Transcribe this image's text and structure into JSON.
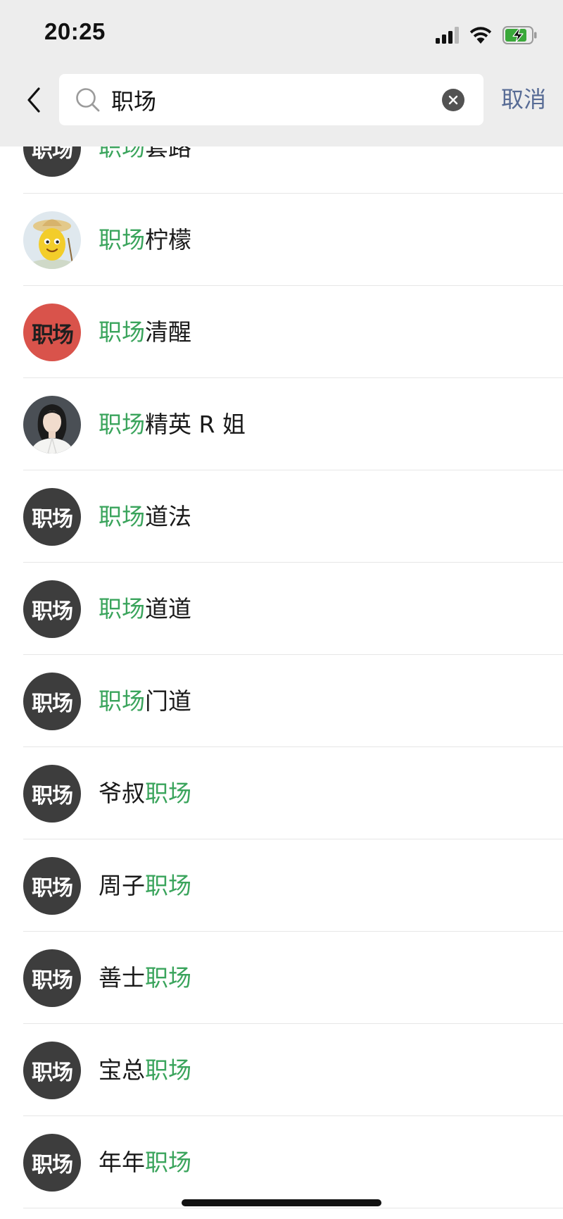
{
  "status_bar": {
    "time": "20:25",
    "signal_icon": "cellular-signal-icon",
    "wifi_icon": "wifi-icon",
    "battery_icon": "battery-charging-icon",
    "battery_color": "#3aa83a"
  },
  "search": {
    "query": "职场",
    "placeholder": "",
    "cancel_label": "取消",
    "back_icon": "chevron-left-icon",
    "search_icon": "search-icon",
    "clear_icon": "clear-icon"
  },
  "colors": {
    "header_bg": "#ededed",
    "highlight": "#3aa45c",
    "link": "#576b95",
    "avatar_dark": "#3d3d3d",
    "avatar_red": "#d9534b"
  },
  "results": [
    {
      "avatar": {
        "type": "text",
        "text": "职场"
      },
      "before": "",
      "match": "职场",
      "after": "套路"
    },
    {
      "avatar": {
        "type": "illustration",
        "text": ""
      },
      "before": "",
      "match": "职场",
      "after": "柠檬"
    },
    {
      "avatar": {
        "type": "text-red",
        "text": "职场"
      },
      "before": "",
      "match": "职场",
      "after": "清醒"
    },
    {
      "avatar": {
        "type": "portrait",
        "text": ""
      },
      "before": "",
      "match": "职场",
      "after": "精英 R 姐"
    },
    {
      "avatar": {
        "type": "text",
        "text": "职场"
      },
      "before": "",
      "match": "职场",
      "after": "道法"
    },
    {
      "avatar": {
        "type": "text",
        "text": "职场"
      },
      "before": "",
      "match": "职场",
      "after": "道道"
    },
    {
      "avatar": {
        "type": "text",
        "text": "职场"
      },
      "before": "",
      "match": "职场",
      "after": "门道"
    },
    {
      "avatar": {
        "type": "text",
        "text": "职场"
      },
      "before": "爷叔",
      "match": "职场",
      "after": ""
    },
    {
      "avatar": {
        "type": "text",
        "text": "职场"
      },
      "before": "周子",
      "match": "职场",
      "after": ""
    },
    {
      "avatar": {
        "type": "text",
        "text": "职场"
      },
      "before": "善士",
      "match": "职场",
      "after": ""
    },
    {
      "avatar": {
        "type": "text",
        "text": "职场"
      },
      "before": "宝总",
      "match": "职场",
      "after": ""
    },
    {
      "avatar": {
        "type": "text",
        "text": "职场"
      },
      "before": "年年",
      "match": "职场",
      "after": ""
    }
  ]
}
